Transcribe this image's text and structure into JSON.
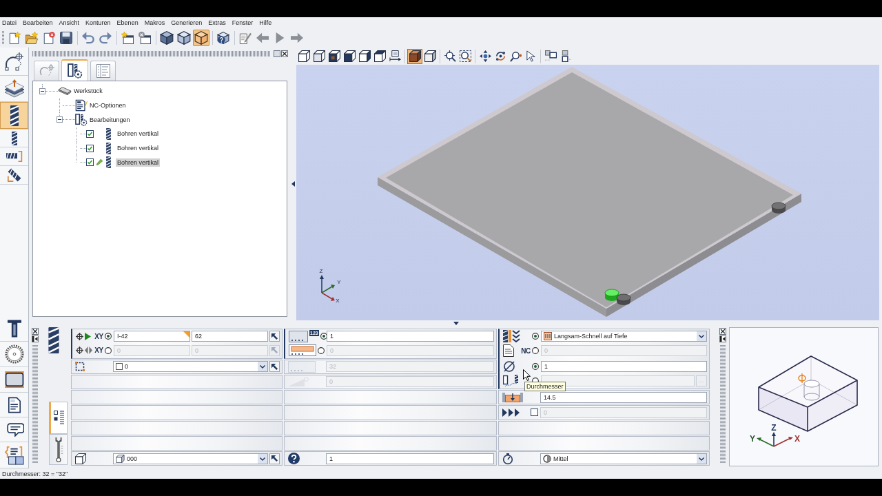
{
  "menu_bar": [
    "Datei",
    "Bearbeiten",
    "Ansicht",
    "Konturen",
    "Ebenen",
    "Makros",
    "Generieren",
    "Extras",
    "Fenster",
    "Hilfe"
  ],
  "toolbar": {
    "display_modes": [
      {
        "selected": false
      },
      {
        "selected": false
      },
      {
        "selected": true
      }
    ]
  },
  "tool_palette": [
    {
      "selected": false
    },
    {
      "selected": false
    },
    {
      "selected": true
    },
    {
      "selected": false
    },
    {
      "selected": false
    },
    {
      "selected": false
    },
    {
      "selected": false
    },
    {
      "selected": false
    },
    {
      "selected": false
    },
    {
      "selected": false
    },
    {
      "selected": false
    },
    {
      "selected": false
    }
  ],
  "panel_tabs": [
    {
      "selected": false
    },
    {
      "selected": true
    },
    {
      "selected": false
    }
  ],
  "tree": [
    {
      "kind": "workpiece",
      "label": "Werkstück",
      "expanded": true,
      "selected": false,
      "children": [
        {
          "kind": "options",
          "label": "NC-Optionen",
          "selected": false
        },
        {
          "kind": "group",
          "label": "Bearbeitungen",
          "expanded": true,
          "selected": false,
          "children": [
            {
              "kind": "operation",
              "label": "Bohren vertikal",
              "checked": true,
              "editing": false,
              "selected": false
            },
            {
              "kind": "operation",
              "label": "Bohren vertikal",
              "checked": true,
              "editing": false,
              "selected": false
            },
            {
              "kind": "operation",
              "label": "Bohren vertikal",
              "checked": true,
              "editing": true,
              "selected": true
            }
          ]
        }
      ]
    }
  ],
  "viewport": {
    "render_modes": [
      {
        "selected": true
      },
      {
        "selected": false
      }
    ],
    "axis_labels": [
      "Z",
      "Y",
      "X"
    ]
  },
  "operation_tabs": [
    {
      "selected": true
    },
    {
      "selected": false
    }
  ],
  "parameters": {
    "columns": [
      {
        "rows": [
          {
            "kind": "point",
            "label": "XY",
            "selected": true,
            "disabled": false,
            "fields": [
              {
                "value": "I-42",
                "flagged": true
              },
              {
                "value": "62",
                "flagged": false
              }
            ]
          },
          {
            "kind": "point",
            "label": "XY",
            "selected": false,
            "disabled": true,
            "fields": [
              {
                "value": "0",
                "flagged": false
              },
              {
                "value": "0",
                "flagged": false
              }
            ]
          },
          {
            "kind": "reference",
            "value": "0"
          },
          {
            "kind": "empty"
          },
          {
            "kind": "empty"
          },
          {
            "kind": "empty"
          },
          {
            "kind": "empty"
          },
          {
            "kind": "empty"
          },
          {
            "kind": "reference",
            "value": "000"
          }
        ]
      },
      {
        "rows": [
          {
            "kind": "field",
            "badge": "123",
            "selected": true,
            "value": "1",
            "disabled": false
          },
          {
            "kind": "field",
            "selected": false,
            "value": "0",
            "disabled": true
          },
          {
            "kind": "field",
            "value": "32",
            "disabled": true
          },
          {
            "kind": "field",
            "value": "0",
            "disabled": true
          },
          {
            "kind": "empty"
          },
          {
            "kind": "empty"
          },
          {
            "kind": "empty"
          },
          {
            "kind": "empty"
          },
          {
            "kind": "field",
            "value": "1",
            "disabled": false
          }
        ]
      },
      {
        "rows": [
          {
            "kind": "select",
            "selected": true,
            "value": "Langsam-Schnell auf Tiefe"
          },
          {
            "kind": "field",
            "label": "NC",
            "selected": false,
            "value": "0",
            "disabled": true
          },
          {
            "kind": "field",
            "selected": true,
            "value": "1",
            "disabled": false
          },
          {
            "kind": "field",
            "selected": false,
            "disabled": true,
            "button": "..."
          },
          {
            "kind": "field",
            "value": "14.5",
            "disabled": false
          },
          {
            "kind": "field",
            "checked": false,
            "value": "0",
            "disabled": true
          },
          {
            "kind": "empty"
          },
          {
            "kind": "empty"
          },
          {
            "kind": "select",
            "value": "Mittel"
          }
        ]
      }
    ]
  },
  "tooltip": "Durchmesser",
  "preview": {
    "axis_labels": [
      "Z",
      "Y",
      "X"
    ]
  },
  "status_bar": "Durchmesser: 32 = \"32\""
}
